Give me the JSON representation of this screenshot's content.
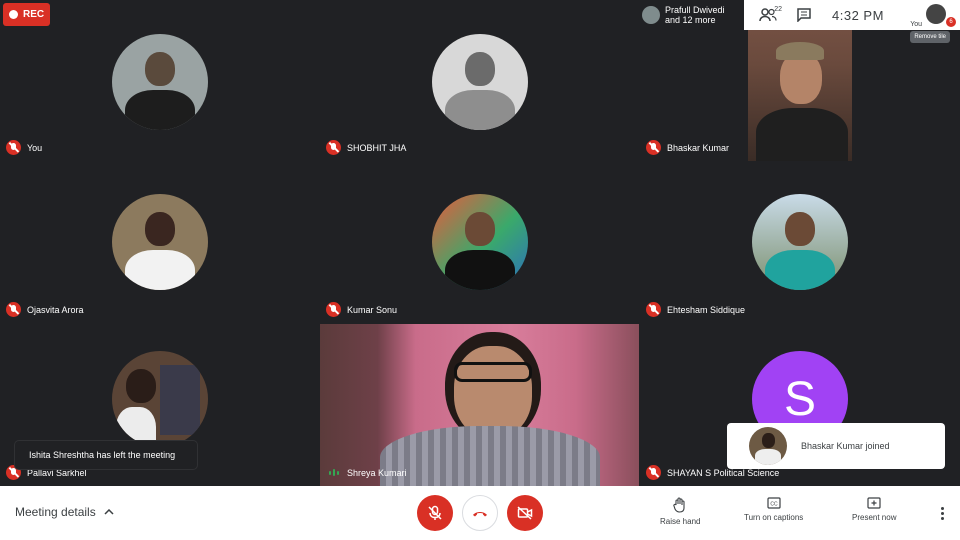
{
  "recording": {
    "label": "REC"
  },
  "presenter": {
    "line1": "Prafull Dwivedi",
    "line2": "and 12 more"
  },
  "header": {
    "participants_count": "22",
    "time": "4:32  PM",
    "you_label": "You",
    "notification_count": "6",
    "remove_tile": "Remove tile"
  },
  "tiles": [
    {
      "name": "You"
    },
    {
      "name": "SHOBHIT JHA"
    },
    {
      "name": "Bhaskar Kumar"
    },
    {
      "name": "Ojasvita Arora"
    },
    {
      "name": "Kumar Sonu"
    },
    {
      "name": "Ehtesham Siddique"
    },
    {
      "name": "Pallavi Sarkhel"
    },
    {
      "name": "Shreya Kumari"
    },
    {
      "name": "SHAYAN S Political Science",
      "initial": "S"
    }
  ],
  "toasts": {
    "left": "Ishita Shreshtha has left the meeting",
    "right": "Bhaskar Kumar joined"
  },
  "bottombar": {
    "meeting_details": "Meeting details",
    "raise_hand": "Raise hand",
    "captions": "Turn on captions",
    "present": "Present now"
  },
  "colors": {
    "mic_off": "#d93025",
    "background": "#202124",
    "avatar_purple": "#a142f4",
    "speaking": "#34a853"
  }
}
